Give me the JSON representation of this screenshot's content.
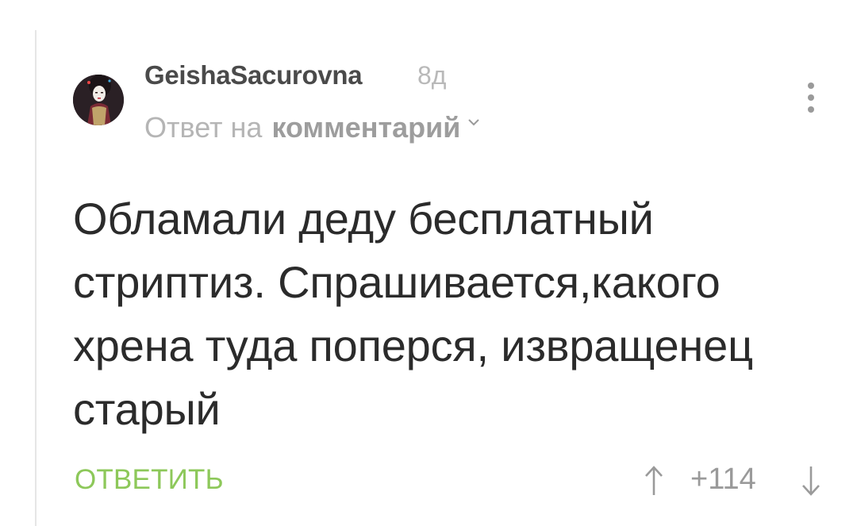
{
  "comment": {
    "author": "GeishaSacurovna",
    "time_ago": "8д",
    "reply_to_prefix": "Ответ на",
    "reply_to_link": "комментарий",
    "text": "Обламали деду бесплатный стриптиз. Спрашивается,какого хрена туда поперся, извращенец старый",
    "reply_label": "ОТВЕТИТЬ",
    "rating": "+114"
  },
  "icons": {
    "avatar": "user-avatar",
    "chevron": "chevron-down-icon",
    "menu": "more-vertical-icon",
    "upvote": "arrow-up-icon",
    "downvote": "arrow-down-icon"
  },
  "colors": {
    "accent_green": "#8dc85a",
    "text_dark": "#2b2b2b",
    "text_muted": "#b5b5b5"
  }
}
